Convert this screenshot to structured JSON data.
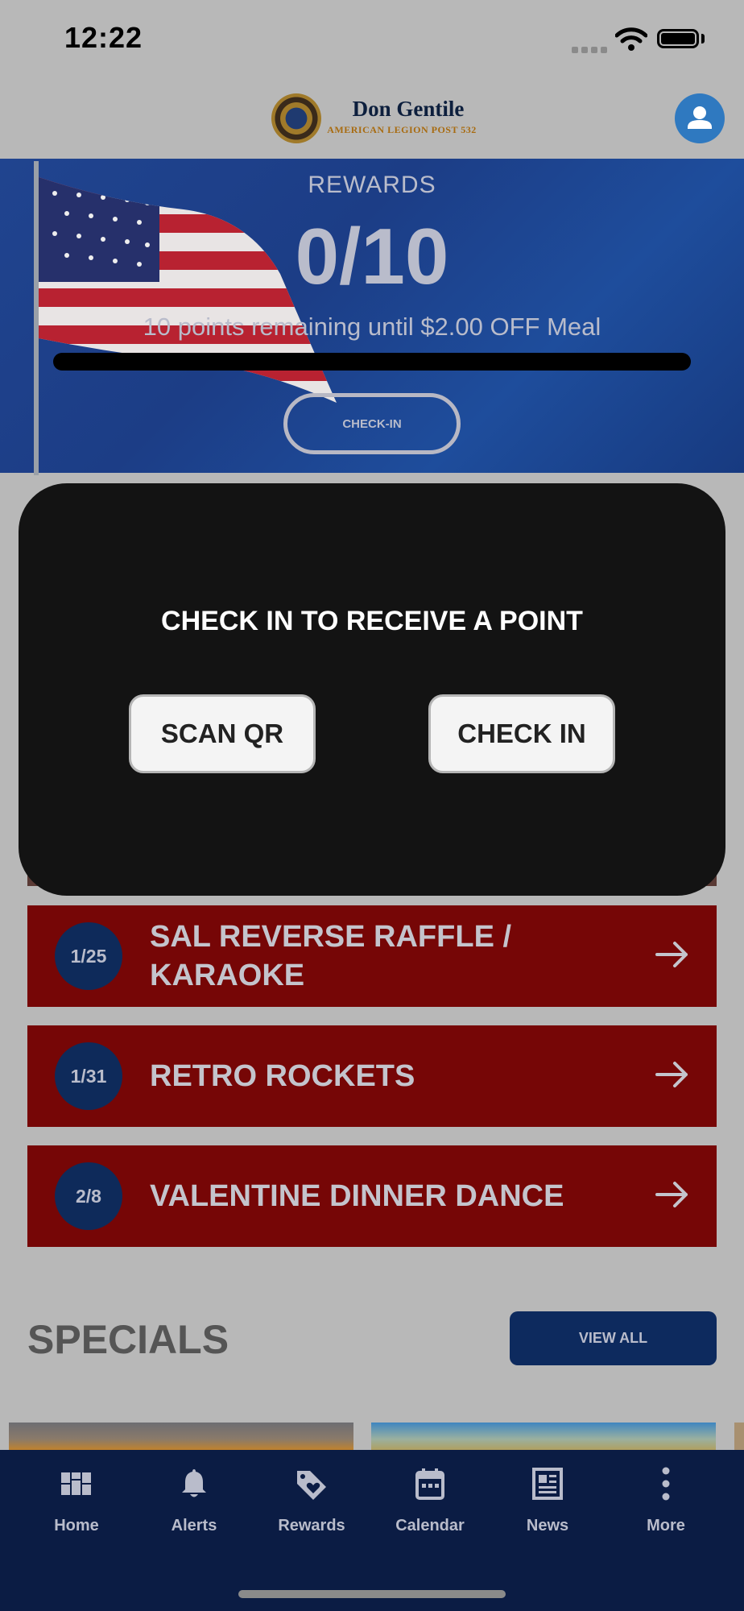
{
  "status_bar": {
    "time": "12:22"
  },
  "header": {
    "logo_title": "Don Gentile",
    "logo_subtitle": "AMERICAN LEGION POST 532"
  },
  "rewards": {
    "label": "REWARDS",
    "count": "0/10",
    "remaining_text": "10 points remaining until $2.00 OFF Meal",
    "progress": 0,
    "checkin_label": "CHECK-IN"
  },
  "modal": {
    "title": "CHECK IN TO RECEIVE A POINT",
    "scan_label": "SCAN QR",
    "checkin_label": "CHECK IN"
  },
  "events": [
    {
      "date": "1/25",
      "title": "SAL REVERSE RAFFLE / KARAOKE"
    },
    {
      "date": "1/31",
      "title": "RETRO ROCKETS"
    },
    {
      "date": "2/8",
      "title": "VALENTINE DINNER DANCE"
    }
  ],
  "specials": {
    "title": "SPECIALS",
    "view_all": "VIEW ALL"
  },
  "nav": [
    {
      "label": "Home",
      "icon": "home-grid-icon"
    },
    {
      "label": "Alerts",
      "icon": "bell-icon"
    },
    {
      "label": "Rewards",
      "icon": "tag-heart-icon"
    },
    {
      "label": "Calendar",
      "icon": "calendar-icon"
    },
    {
      "label": "News",
      "icon": "newspaper-icon"
    },
    {
      "label": "More",
      "icon": "more-vertical-icon"
    }
  ],
  "colors": {
    "banner_blue": "#1e4d9c",
    "event_red": "#760606",
    "nav_navy": "#0b1c44",
    "profile_blue": "#2f79c0"
  }
}
